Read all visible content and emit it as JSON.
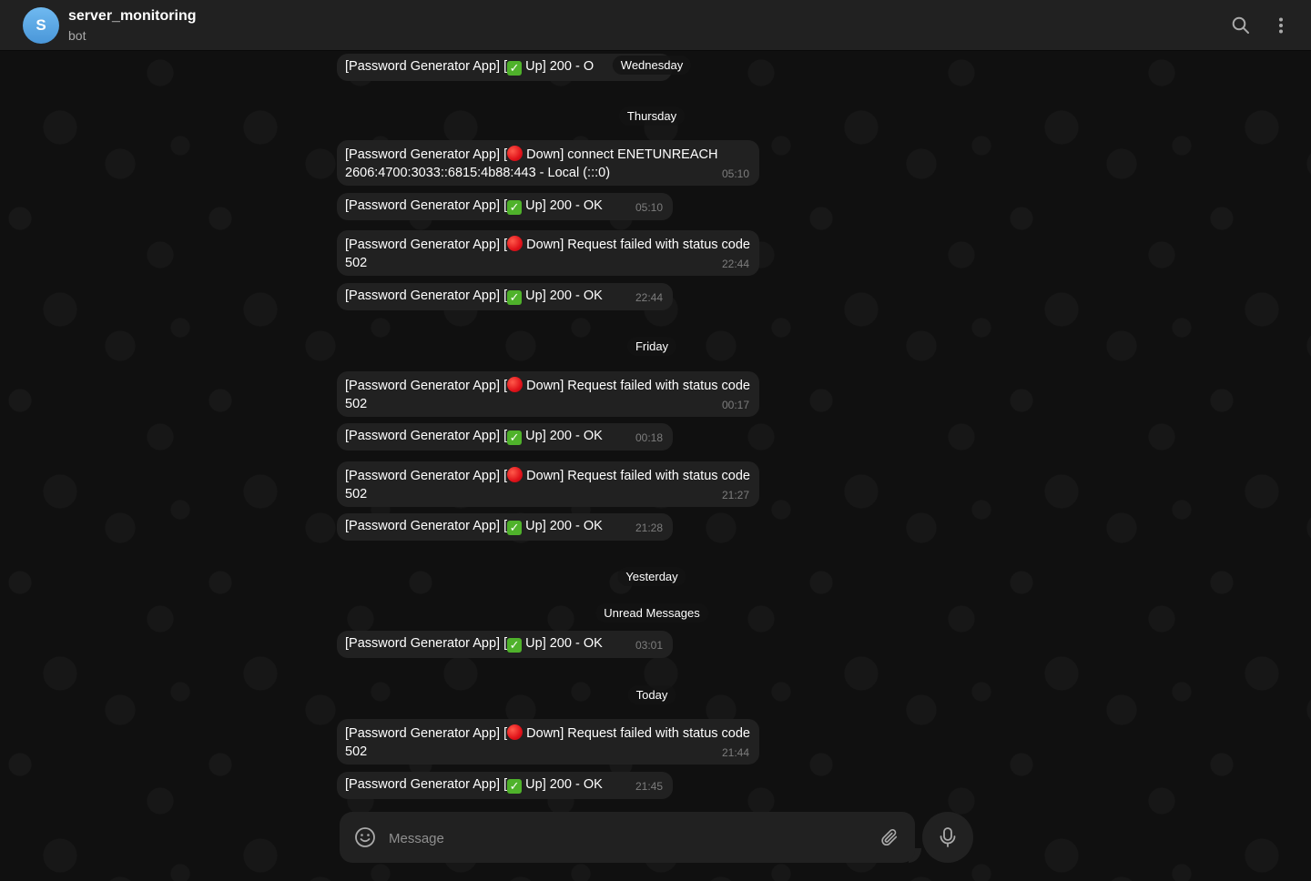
{
  "header": {
    "avatar_letter": "S",
    "chat_name": "server_monitoring",
    "chat_status": "bot",
    "avatar_color": "#5aa8e6"
  },
  "messages": [
    {
      "kind": "up",
      "prefix": "[Password Generator App] [",
      "body": " Up] 200 - O",
      "time": ""
    },
    {
      "kind": "down",
      "prefix": "[Password Generator App] [",
      "body": " Down] connect ENETUNREACH 2606:4700:3033::6815:4b88:443 - Local (:::0)",
      "time": "05:10"
    },
    {
      "kind": "up",
      "prefix": "[Password Generator App] [",
      "body": " Up] 200 - OK",
      "time": "05:10"
    },
    {
      "kind": "down",
      "prefix": "[Password Generator App] [",
      "body": " Down] Request failed with status code 502",
      "time": "22:44"
    },
    {
      "kind": "up",
      "prefix": "[Password Generator App] [",
      "body": " Up] 200 - OK",
      "time": "22:44"
    },
    {
      "kind": "down",
      "prefix": "[Password Generator App] [",
      "body": " Down] Request failed with status code 502",
      "time": "00:17"
    },
    {
      "kind": "up",
      "prefix": "[Password Generator App] [",
      "body": " Up] 200 - OK",
      "time": "00:18"
    },
    {
      "kind": "down",
      "prefix": "[Password Generator App] [",
      "body": " Down] Request failed with status code 502",
      "time": "21:27"
    },
    {
      "kind": "up",
      "prefix": "[Password Generator App] [",
      "body": " Up] 200 - OK",
      "time": "21:28"
    },
    {
      "kind": "up",
      "prefix": "[Password Generator App] [",
      "body": " Up] 200 - OK",
      "time": "03:01"
    },
    {
      "kind": "down",
      "prefix": "[Password Generator App] [",
      "body": " Down] Request failed with status code 502",
      "time": "21:44"
    },
    {
      "kind": "up",
      "prefix": "[Password Generator App] [",
      "body": " Up] 200 - OK",
      "time": "21:45"
    }
  ],
  "dates": {
    "wednesday": "Wednesday",
    "thursday": "Thursday",
    "friday": "Friday",
    "yesterday": "Yesterday",
    "unread": "Unread Messages",
    "today": "Today"
  },
  "composer": {
    "placeholder": "Message"
  },
  "icons": {
    "search": "search-icon",
    "more": "more-vertical-icon",
    "emoji": "smiley-icon",
    "attach": "paperclip-icon",
    "mic": "microphone-icon",
    "up_status": "check-mark-button-emoji",
    "down_status": "red-circle-emoji"
  },
  "colors": {
    "header_bg": "#212121",
    "bubble_bg": "#212121",
    "up_emoji": "#4fb22b",
    "down_emoji": "#e0121a"
  }
}
